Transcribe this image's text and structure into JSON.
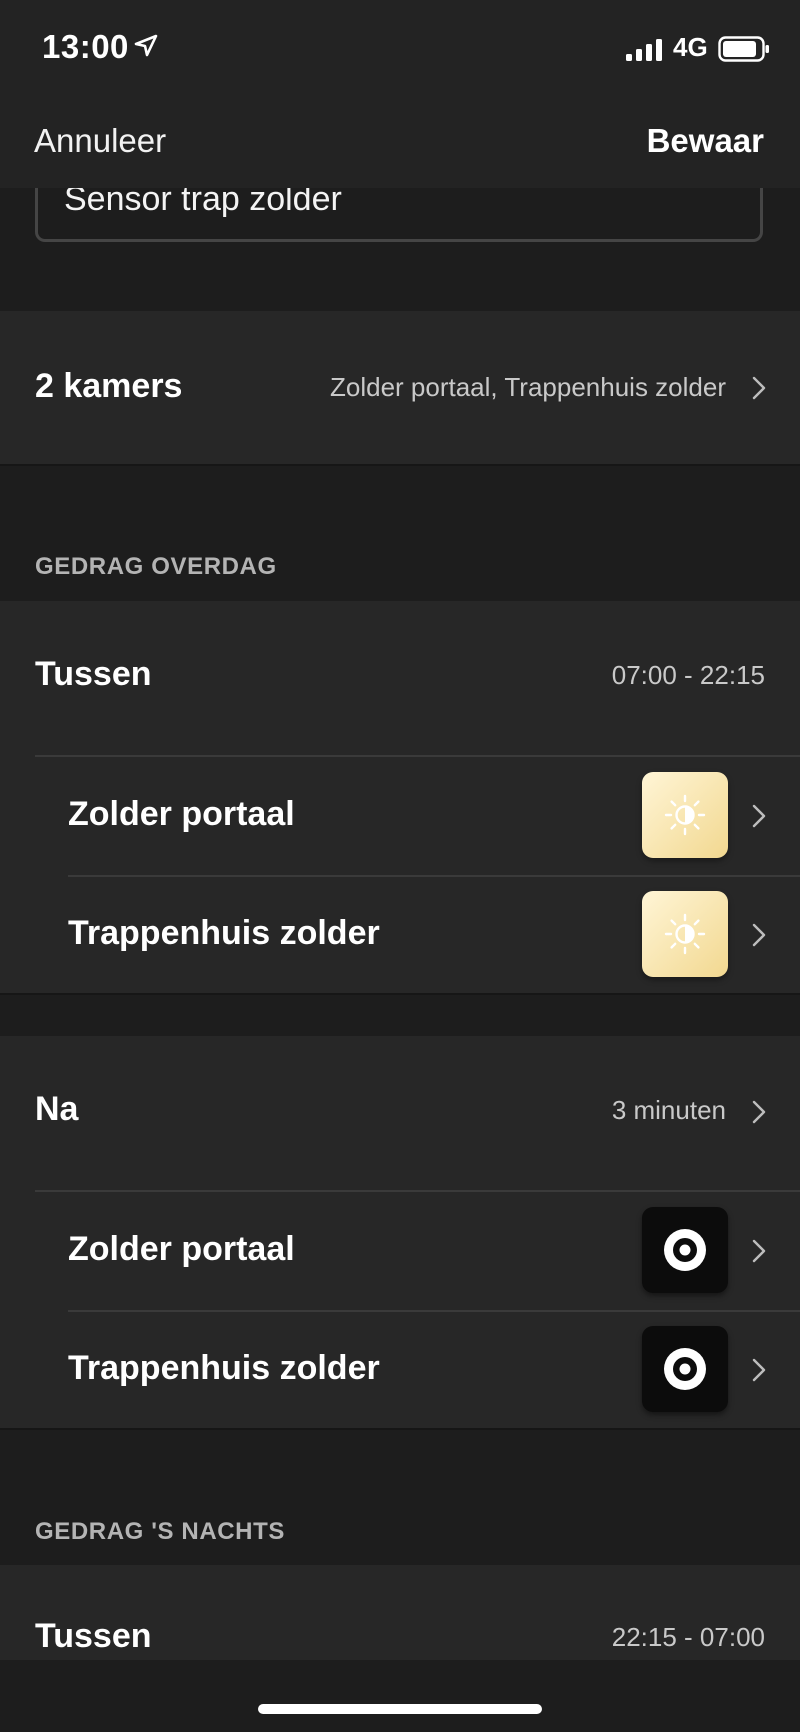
{
  "status_bar": {
    "time": "13:00",
    "network": "4G"
  },
  "nav": {
    "cancel_label": "Annuleer",
    "save_label": "Bewaar"
  },
  "sensor_name": {
    "value": "Sensor trap zolder"
  },
  "rooms": {
    "count_label": "2 kamers",
    "summary": "Zolder portaal, Trappenhuis zolder"
  },
  "day": {
    "section_title": "GEDRAG OVERDAG",
    "between": {
      "label": "Tussen",
      "value": "07:00 - 22:15"
    },
    "between_rooms": [
      {
        "name": "Zolder portaal",
        "icon": "scene-brightness-icon"
      },
      {
        "name": "Trappenhuis zolder",
        "icon": "scene-brightness-icon"
      }
    ],
    "after": {
      "label": "Na",
      "value": "3 minuten"
    },
    "after_rooms": [
      {
        "name": "Zolder portaal",
        "icon": "power-off-icon"
      },
      {
        "name": "Trappenhuis zolder",
        "icon": "power-off-icon"
      }
    ]
  },
  "night": {
    "section_title": "GEDRAG 'S NACHTS",
    "between": {
      "label": "Tussen",
      "value": "22:15 - 07:00"
    }
  },
  "colors": {
    "background": "#1d1d1d",
    "panel": "#272727",
    "scene_warm": "#f2d890"
  }
}
